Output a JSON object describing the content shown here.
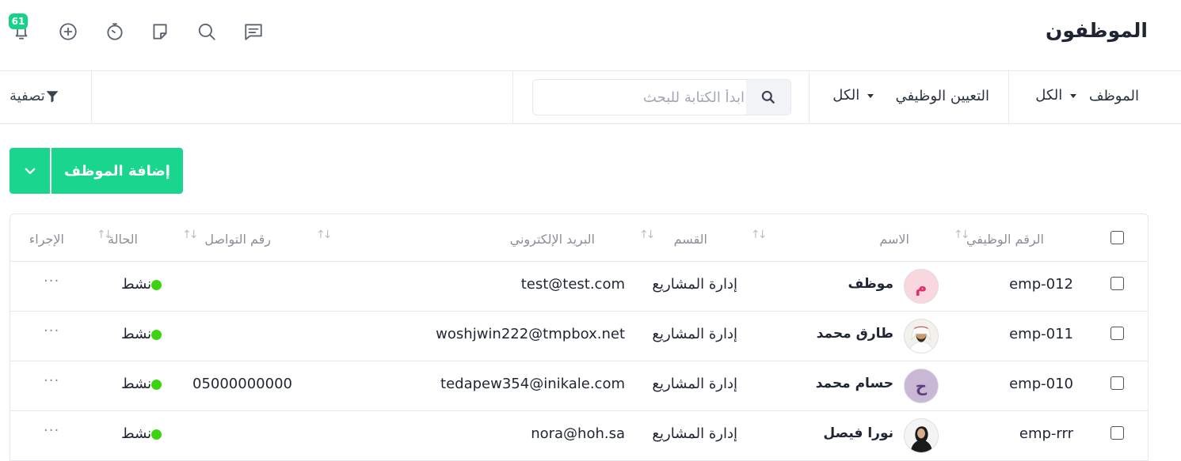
{
  "header": {
    "title": "الموظفون",
    "notification_count": "61",
    "icons": [
      "bell-icon",
      "plus-circle-icon",
      "timer-icon",
      "note-icon",
      "search-icon",
      "chat-icon"
    ]
  },
  "filters": {
    "employee_label": "الموظف",
    "employee_value": "الكل",
    "job_assignment_label": "التعيين الوظيفي",
    "job_assignment_value": "الكل",
    "search_placeholder": "ابدأ الكتابة للبحث",
    "filter_button": "تصفية"
  },
  "actions": {
    "add_employee": "إضافة الموظف"
  },
  "table": {
    "columns": {
      "employee_id": "الرقم الوظيفي",
      "name": "الاسم",
      "department": "القسم",
      "email": "البريد الإلكتروني",
      "phone": "رقم التواصل",
      "status": "الحالة",
      "action": "الإجراء"
    },
    "rows": [
      {
        "employee_id": "emp-012",
        "name": "موظف",
        "avatar_letter": "م",
        "avatar_bg": "#f9d7df",
        "avatar_fg": "#e3306b",
        "department": "إدارة المشاريع",
        "email": "test@test.com",
        "phone": "",
        "status": "نشط",
        "more": "···"
      },
      {
        "employee_id": "emp-011",
        "name": "طارق محمد",
        "avatar_letter": "",
        "avatar_bg": "#f3f1ee",
        "avatar_fg": "#555",
        "department": "إدارة المشاريع",
        "email": "woshjwin222@tmpbox.net",
        "phone": "",
        "status": "نشط",
        "more": "···"
      },
      {
        "employee_id": "emp-010",
        "name": "حسام محمد",
        "avatar_letter": "ح",
        "avatar_bg": "#c9b7d6",
        "avatar_fg": "#5f3f78",
        "department": "إدارة المشاريع",
        "email": "tedapew354@inikale.com",
        "phone": "05000000000",
        "status": "نشط",
        "more": "···"
      },
      {
        "employee_id": "emp-rrr",
        "name": "نورا فيصل",
        "avatar_letter": "",
        "avatar_bg": "#f4f4f4",
        "avatar_fg": "#333",
        "department": "إدارة المشاريع",
        "email": "nora@hoh.sa",
        "phone": "",
        "status": "نشط",
        "more": "···"
      }
    ]
  },
  "colors": {
    "accent": "#19d58e",
    "status_active": "#3bd40f"
  }
}
